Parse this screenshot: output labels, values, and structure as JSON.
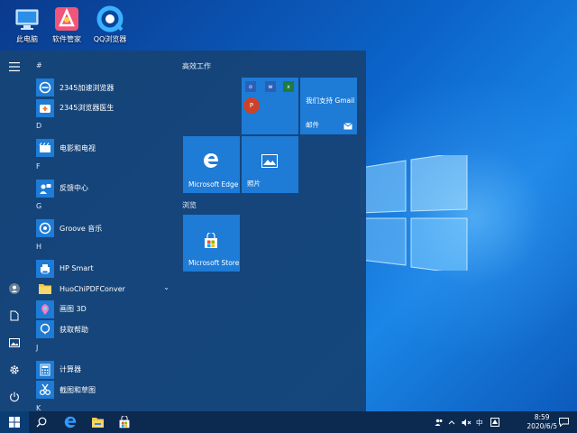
{
  "desktop": {
    "icons": [
      {
        "label": "此电脑",
        "icon": "computer-icon"
      },
      {
        "label": "软件管家",
        "icon": "software-manager-icon"
      },
      {
        "label": "QQ浏览器",
        "icon": "qq-browser-icon"
      }
    ]
  },
  "start_menu": {
    "rail": [
      "hamburger-icon",
      "user-avatar-icon",
      "documents-icon",
      "pictures-icon",
      "settings-icon",
      "power-icon"
    ],
    "sections": [
      {
        "letter": "#",
        "apps": [
          {
            "name": "2345加速浏览器",
            "icon": "browser-2345-icon",
            "color": "#1e7bd6"
          },
          {
            "name": "2345浏览器医生",
            "icon": "browser-doctor-icon",
            "color": "#ffffff"
          }
        ]
      },
      {
        "letter": "D",
        "apps": [
          {
            "name": "电影和电视",
            "icon": "movies-tv-icon",
            "color": "#1e7bd6"
          }
        ]
      },
      {
        "letter": "F",
        "apps": [
          {
            "name": "反馈中心",
            "icon": "feedback-icon",
            "color": "#1e7bd6"
          }
        ]
      },
      {
        "letter": "G",
        "apps": [
          {
            "name": "Groove 音乐",
            "icon": "groove-music-icon",
            "color": "#1e7bd6"
          }
        ]
      },
      {
        "letter": "H",
        "apps": [
          {
            "name": "HP Smart",
            "icon": "hp-smart-icon",
            "color": "#1e7bd6"
          },
          {
            "name": "HuoChiPDFConver",
            "icon": "folder-icon",
            "color": "#f2c94c",
            "expandable": true
          },
          {
            "name": "画图 3D",
            "icon": "paint-3d-icon",
            "color": "#1e7bd6"
          },
          {
            "name": "获取帮助",
            "icon": "get-help-icon",
            "color": "#1e7bd6"
          }
        ]
      },
      {
        "letter": "J",
        "apps": [
          {
            "name": "计算器",
            "icon": "calculator-icon",
            "color": "#1e7bd6"
          },
          {
            "name": "截图和草图",
            "icon": "snip-sketch-icon",
            "color": "#1e7bd6"
          }
        ]
      },
      {
        "letter": "K",
        "apps": []
      }
    ],
    "groups": {
      "productivity": "高效工作",
      "browse": "浏览"
    },
    "tiles": {
      "office": {
        "label": ""
      },
      "mail": {
        "title": "我们支持 Gmail",
        "label": "邮件"
      },
      "edge": {
        "label": "Microsoft Edge"
      },
      "photos": {
        "label": "照片"
      },
      "store": {
        "label": "Microsoft Store"
      }
    }
  },
  "taskbar": {
    "items": [
      "start-button",
      "search-icon",
      "edge-icon",
      "file-explorer-icon",
      "store-icon"
    ],
    "tray": {
      "ime": "中",
      "time": "8:59",
      "date": "2020/6/5"
    }
  },
  "colors": {
    "tile": "#1e7bd6",
    "start_bg": "#164478",
    "taskbar": "#0c2a50"
  }
}
